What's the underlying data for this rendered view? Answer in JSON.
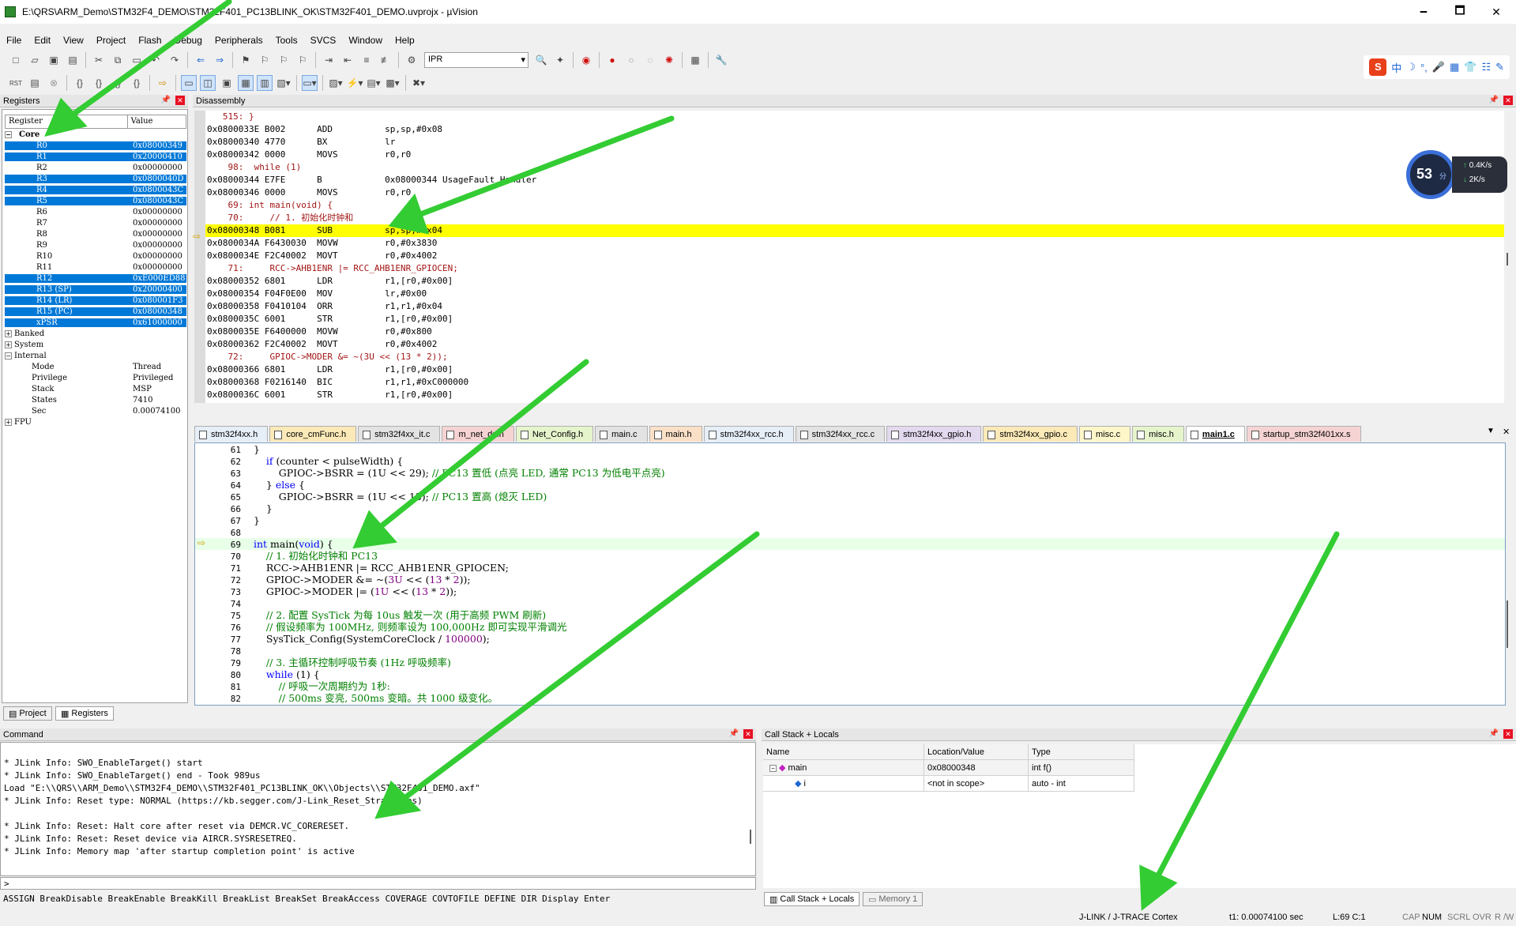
{
  "window": {
    "title": "E:\\QRS\\ARM_Demo\\STM32F4_DEMO\\STM32F401_PC13BLINK_OK\\STM32F401_DEMO.uvprojx - µVision",
    "minimize": "🗕",
    "maximize": "🗖",
    "close": "✕"
  },
  "menu": [
    "File",
    "Edit",
    "View",
    "Project",
    "Flash",
    "Debug",
    "Peripherals",
    "Tools",
    "SVCS",
    "Window",
    "Help"
  ],
  "toolbar": {
    "combo_value": "IPR"
  },
  "registers": {
    "header": "Registers",
    "col_register": "Register",
    "col_value": "Value",
    "core_label": "Core",
    "rows": [
      {
        "name": "R0",
        "value": "0x08000349",
        "sel": true
      },
      {
        "name": "R1",
        "value": "0x20000410",
        "sel": true
      },
      {
        "name": "R2",
        "value": "0x00000000",
        "sel": false
      },
      {
        "name": "R3",
        "value": "0x0800040D",
        "sel": true
      },
      {
        "name": "R4",
        "value": "0x0800043C",
        "sel": true
      },
      {
        "name": "R5",
        "value": "0x0800043C",
        "sel": true
      },
      {
        "name": "R6",
        "value": "0x00000000",
        "sel": false
      },
      {
        "name": "R7",
        "value": "0x00000000",
        "sel": false
      },
      {
        "name": "R8",
        "value": "0x00000000",
        "sel": false
      },
      {
        "name": "R9",
        "value": "0x00000000",
        "sel": false
      },
      {
        "name": "R10",
        "value": "0x00000000",
        "sel": false
      },
      {
        "name": "R11",
        "value": "0x00000000",
        "sel": false
      },
      {
        "name": "R12",
        "value": "0xE000ED88",
        "sel": true
      },
      {
        "name": "R13 (SP)",
        "value": "0x20000400",
        "sel": true
      },
      {
        "name": "R14 (LR)",
        "value": "0x080001F3",
        "sel": true
      },
      {
        "name": "R15 (PC)",
        "value": "0x08000348",
        "sel": true
      },
      {
        "name": "xPSR",
        "value": "0x61000000",
        "sel": true
      }
    ],
    "groups": [
      "Banked",
      "System",
      "Internal"
    ],
    "internal": [
      {
        "name": "Mode",
        "value": "Thread"
      },
      {
        "name": "Privilege",
        "value": "Privileged"
      },
      {
        "name": "Stack",
        "value": "MSP"
      },
      {
        "name": "States",
        "value": "7410"
      },
      {
        "name": "Sec",
        "value": "0.00074100"
      }
    ],
    "fpu": "FPU",
    "tab_project": "Project",
    "tab_registers": "Registers"
  },
  "disassembly": {
    "header": "Disassembly",
    "lines": [
      {
        "t": "   515: }",
        "k": "src"
      },
      {
        "t": "0x0800033E B002      ADD          sp,sp,#0x08",
        "k": ""
      },
      {
        "t": "0x08000340 4770      BX           lr",
        "k": ""
      },
      {
        "t": "0x08000342 0000      MOVS         r0,r0",
        "k": ""
      },
      {
        "t": "    98:  while (1)",
        "k": "src"
      },
      {
        "t": "0x08000344 E7FE      B            0x08000344 UsageFault_Handler",
        "k": ""
      },
      {
        "t": "0x08000346 0000      MOVS         r0,r0",
        "k": ""
      },
      {
        "t": "    69: int main(void) {",
        "k": "src"
      },
      {
        "t": "    70:     // 1. 初始化时钟和",
        "k": "src"
      },
      {
        "t": "0x08000348 B081      SUB          sp,sp,#0x04",
        "k": "cur"
      },
      {
        "t": "0x0800034A F6430030  MOVW         r0,#0x3830",
        "k": ""
      },
      {
        "t": "0x0800034E F2C40002  MOVT         r0,#0x4002",
        "k": ""
      },
      {
        "t": "    71:     RCC->AHB1ENR |= RCC_AHB1ENR_GPIOCEN;",
        "k": "src"
      },
      {
        "t": "0x08000352 6801      LDR          r1,[r0,#0x00]",
        "k": ""
      },
      {
        "t": "0x08000354 F04F0E00  MOV          lr,#0x00",
        "k": ""
      },
      {
        "t": "0x08000358 F0410104  ORR          r1,r1,#0x04",
        "k": ""
      },
      {
        "t": "0x0800035C 6001      STR          r1,[r0,#0x00]",
        "k": ""
      },
      {
        "t": "0x0800035E F6400000  MOVW         r0,#0x800",
        "k": ""
      },
      {
        "t": "0x08000362 F2C40002  MOVT         r0,#0x4002",
        "k": ""
      },
      {
        "t": "    72:     GPIOC->MODER &= ~(3U << (13 * 2));",
        "k": "src"
      },
      {
        "t": "0x08000366 6801      LDR          r1,[r0,#0x00]",
        "k": ""
      },
      {
        "t": "0x08000368 F0216140  BIC          r1,r1,#0xC000000",
        "k": ""
      },
      {
        "t": "0x0800036C 6001      STR          r1,[r0,#0x00]",
        "k": ""
      }
    ]
  },
  "tabs": [
    {
      "label": "stm32f4xx.h",
      "color": "#e6eef8"
    },
    {
      "label": "core_cmFunc.h",
      "color": "#fbe9b7"
    },
    {
      "label": "stm32f4xx_it.c",
      "color": "#e3e3e3"
    },
    {
      "label": "m_net_ds.h",
      "color": "#f6d3d3"
    },
    {
      "label": "Net_Config.h",
      "color": "#e6f4cc"
    },
    {
      "label": "main.c",
      "color": "#e3e3e3"
    },
    {
      "label": "main.h",
      "color": "#fbe0c8"
    },
    {
      "label": "stm32f4xx_rcc.h",
      "color": "#e6eef8"
    },
    {
      "label": "stm32f4xx_rcc.c",
      "color": "#e3e3e3"
    },
    {
      "label": "stm32f4xx_gpio.h",
      "color": "#e3d9ef"
    },
    {
      "label": "stm32f4xx_gpio.c",
      "color": "#fbe9b7"
    },
    {
      "label": "misc.c",
      "color": "#fdf6c8"
    },
    {
      "label": "misc.h",
      "color": "#e6f4cc"
    },
    {
      "label": "main1.c",
      "color": "#ffffff",
      "active": true
    },
    {
      "label": "startup_stm32f401xx.s",
      "color": "#f6d3d3"
    }
  ],
  "tabs_menu": "▼",
  "tabs_close": "✕",
  "editor": {
    "lines": [
      {
        "n": "61",
        "h": "}"
      },
      {
        "n": "62",
        "h": "    <span class='kw'>if</span> (counter &lt; pulseWidth) {"
      },
      {
        "n": "63",
        "h": "        GPIOC->BSRR = (1U &lt;&lt; 29); <span class='cm'>// PC13 置低 (点亮 LED, 通常 PC13 为低电平点亮)</span>"
      },
      {
        "n": "64",
        "h": "    } <span class='kw'>else</span> {"
      },
      {
        "n": "65",
        "h": "        GPIOC->BSRR = (1U &lt;&lt; 13); <span class='cm'>// PC13 置高 (熄灭 LED)</span>"
      },
      {
        "n": "66",
        "h": "    }"
      },
      {
        "n": "67",
        "h": "}"
      },
      {
        "n": "68",
        "h": ""
      },
      {
        "n": "69",
        "h": "<span class='kw'>int</span> main(<span class='kw'>void</span>) {",
        "cur": true
      },
      {
        "n": "70",
        "h": "    <span class='cm'>// 1. 初始化时钟和 PC13</span>"
      },
      {
        "n": "71",
        "h": "    RCC->AHB1ENR |= RCC_AHB1ENR_GPIOCEN;"
      },
      {
        "n": "72",
        "h": "    GPIOC->MODER &amp;= ~(<span class='nm'>3U</span> &lt;&lt; (<span class='nm'>13</span> * <span class='nm'>2</span>));"
      },
      {
        "n": "73",
        "h": "    GPIOC->MODER |= (<span class='nm'>1U</span> &lt;&lt; (<span class='nm'>13</span> * <span class='nm'>2</span>));"
      },
      {
        "n": "74",
        "h": ""
      },
      {
        "n": "75",
        "h": "    <span class='cm'>// 2. 配置 SysTick 为每 10us 触发一次 (用于高频 PWM 刷新)</span>"
      },
      {
        "n": "76",
        "h": "    <span class='cm'>// 假设频率为 100MHz, 则频率设为 100,000Hz 即可实现平滑调光</span>"
      },
      {
        "n": "77",
        "h": "    SysTick_Config(SystemCoreClock / <span class='nm'>100000</span>);"
      },
      {
        "n": "78",
        "h": ""
      },
      {
        "n": "79",
        "h": "    <span class='cm'>// 3. 主循环控制呼吸节奏 (1Hz 呼吸频率)</span>"
      },
      {
        "n": "80",
        "h": "    <span class='kw'>while</span> (1) {"
      },
      {
        "n": "81",
        "h": "        <span class='cm'>// 呼吸一次周期约为 1秒:</span>"
      },
      {
        "n": "82",
        "h": "        <span class='cm'>// 500ms 变亮, 500ms 变暗。共 1000 级变化。</span>"
      }
    ]
  },
  "command": {
    "header": "Command",
    "lines": [
      "* JLink Info: SWO_EnableTarget() start",
      "* JLink Info: SWO_EnableTarget() end - Took 989us",
      "Load \"E:\\\\QRS\\\\ARM_Demo\\\\STM32F4_DEMO\\\\STM32F401_PC13BLINK_OK\\\\Objects\\\\STM32F401_DEMO.axf\"",
      "* JLink Info: Reset type: NORMAL (https://kb.segger.com/J-Link_Reset_Strategies)",
      "",
      "* JLink Info: Reset: Halt core after reset via DEMCR.VC_CORERESET.",
      "* JLink Info: Reset: Reset device via AIRCR.SYSRESETREQ.",
      "* JLink Info: Memory map 'after startup completion point' is active"
    ],
    "prompt": ">",
    "hint": "ASSIGN BreakDisable BreakEnable BreakKill BreakList BreakSet BreakAccess COVERAGE COVTOFILE DEFINE DIR Display Enter"
  },
  "callstack": {
    "header": "Call Stack + Locals",
    "col_name": "Name",
    "col_loc": "Location/Value",
    "col_type": "Type",
    "rows": [
      {
        "name": "main",
        "loc": "0x08000348",
        "type": "int f()"
      },
      {
        "name": "i",
        "loc": "<not in scope>",
        "type": "auto - int"
      }
    ],
    "tab_cs": "Call Stack + Locals",
    "tab_mem": "Memory 1"
  },
  "status": {
    "debugger": "J-LINK / J-TRACE Cortex",
    "time": "t1: 0.00074100 sec",
    "pos": "L:69 C:1",
    "cap": "CAP",
    "num": "NUM",
    "scrl": "SCRL",
    "ovr": "OVR",
    "rw": "R /W"
  },
  "netgauge": {
    "value": "53",
    "unit": "分",
    "up": "0.4K/s",
    "down": "2K/s"
  },
  "ime": {
    "items": [
      "中",
      "☽",
      "°,",
      "🎤",
      "▦",
      "👕",
      "☷",
      "✎"
    ]
  },
  "colors": {
    "selection": "#0078d7",
    "current_line": "#ffff00",
    "arrow": "#33cc33",
    "comment": "#008000",
    "keyword": "#0000ff"
  }
}
